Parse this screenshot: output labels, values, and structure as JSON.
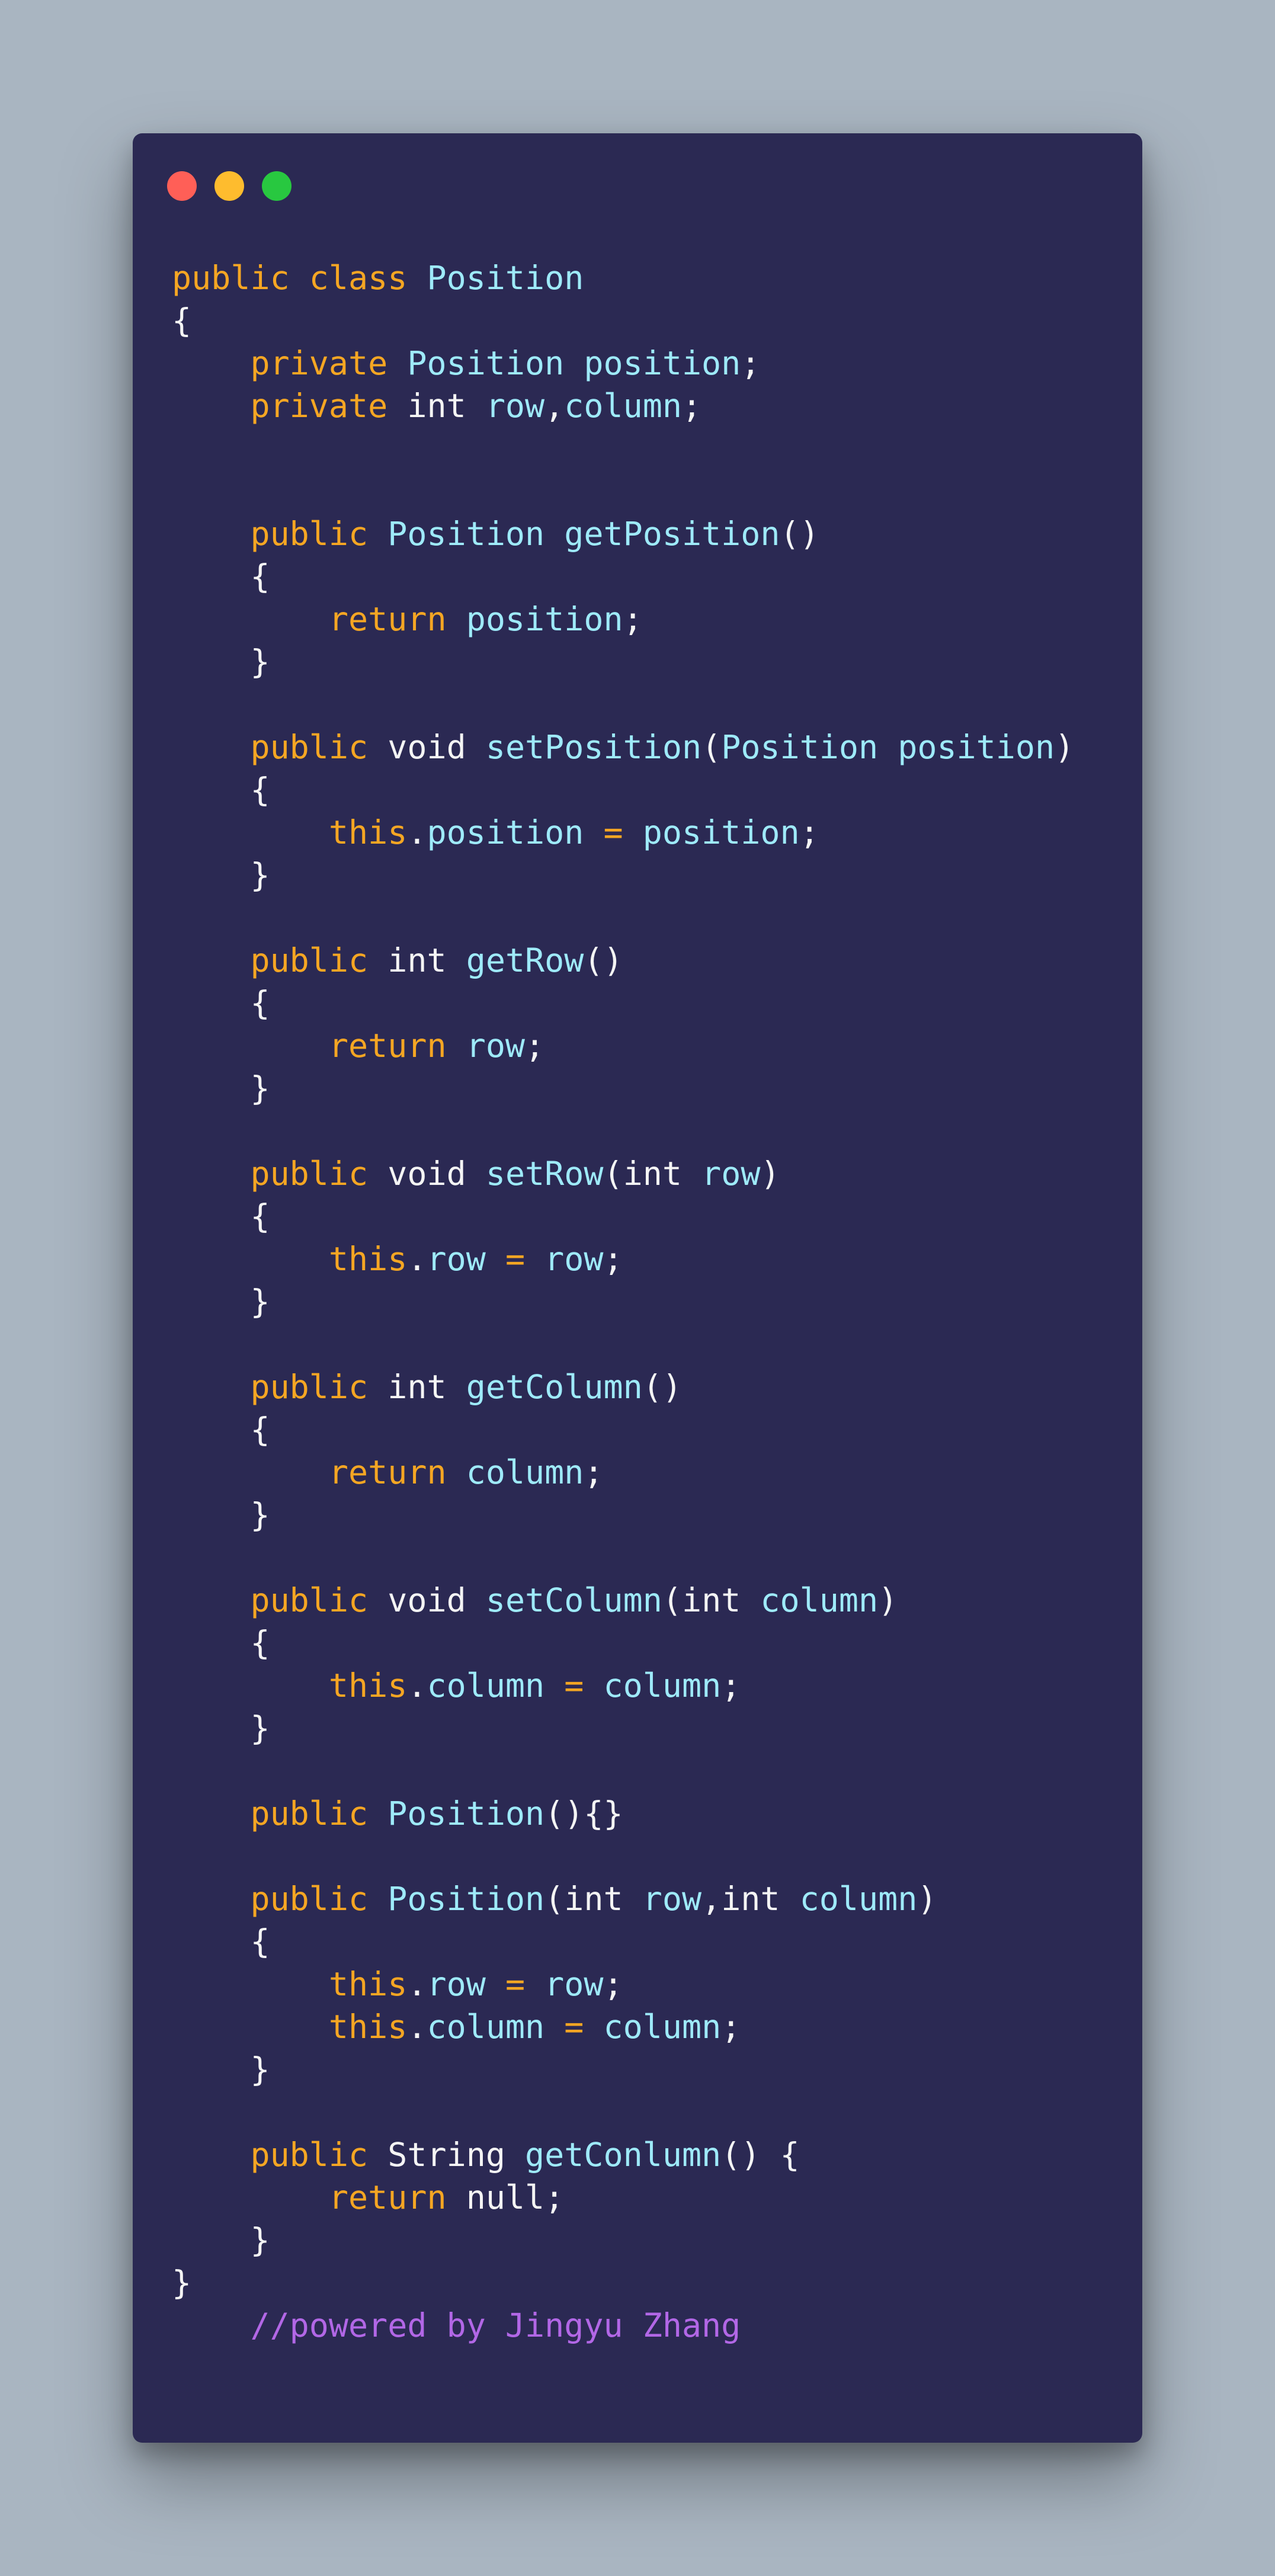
{
  "window": {
    "colors": {
      "background": "#a9b5c1",
      "editor": "#2b2953",
      "keyword": "#f5a623",
      "identifier": "#9eeaf9",
      "plain": "#f4f4f4",
      "comment": "#b267e6"
    },
    "controls": [
      "close-dot",
      "minimize-dot",
      "maximize-dot"
    ]
  },
  "code_lines": [
    [
      {
        "t": "public class ",
        "c": "kw"
      },
      {
        "t": "Position",
        "c": "id"
      }
    ],
    [
      {
        "t": "{",
        "c": "pl"
      }
    ],
    [
      {
        "t": "    private ",
        "c": "kw"
      },
      {
        "t": "Position position",
        "c": "id"
      },
      {
        "t": ";",
        "c": "pl"
      }
    ],
    [
      {
        "t": "    private ",
        "c": "kw"
      },
      {
        "t": "int ",
        "c": "pl"
      },
      {
        "t": "row",
        "c": "id"
      },
      {
        "t": ",",
        "c": "pl"
      },
      {
        "t": "column",
        "c": "id"
      },
      {
        "t": ";",
        "c": "pl"
      }
    ],
    [],
    [],
    [
      {
        "t": "    public ",
        "c": "kw"
      },
      {
        "t": "Position getPosition",
        "c": "id"
      },
      {
        "t": "()",
        "c": "pl"
      }
    ],
    [
      {
        "t": "    {",
        "c": "pl"
      }
    ],
    [
      {
        "t": "        return ",
        "c": "kw"
      },
      {
        "t": "position",
        "c": "id"
      },
      {
        "t": ";",
        "c": "pl"
      }
    ],
    [
      {
        "t": "    }",
        "c": "pl"
      }
    ],
    [],
    [
      {
        "t": "    public ",
        "c": "kw"
      },
      {
        "t": "void ",
        "c": "pl"
      },
      {
        "t": "setPosition",
        "c": "id"
      },
      {
        "t": "(",
        "c": "pl"
      },
      {
        "t": "Position position",
        "c": "id"
      },
      {
        "t": ")",
        "c": "pl"
      }
    ],
    [
      {
        "t": "    {",
        "c": "pl"
      }
    ],
    [
      {
        "t": "        this",
        "c": "kw"
      },
      {
        "t": ".",
        "c": "pl"
      },
      {
        "t": "position ",
        "c": "id"
      },
      {
        "t": "= ",
        "c": "kw"
      },
      {
        "t": "position",
        "c": "id"
      },
      {
        "t": ";",
        "c": "pl"
      }
    ],
    [
      {
        "t": "    }",
        "c": "pl"
      }
    ],
    [],
    [
      {
        "t": "    public ",
        "c": "kw"
      },
      {
        "t": "int ",
        "c": "pl"
      },
      {
        "t": "getRow",
        "c": "id"
      },
      {
        "t": "()",
        "c": "pl"
      }
    ],
    [
      {
        "t": "    {",
        "c": "pl"
      }
    ],
    [
      {
        "t": "        return ",
        "c": "kw"
      },
      {
        "t": "row",
        "c": "id"
      },
      {
        "t": ";",
        "c": "pl"
      }
    ],
    [
      {
        "t": "    }",
        "c": "pl"
      }
    ],
    [],
    [
      {
        "t": "    public ",
        "c": "kw"
      },
      {
        "t": "void ",
        "c": "pl"
      },
      {
        "t": "setRow",
        "c": "id"
      },
      {
        "t": "(int ",
        "c": "pl"
      },
      {
        "t": "row",
        "c": "id"
      },
      {
        "t": ")",
        "c": "pl"
      }
    ],
    [
      {
        "t": "    {",
        "c": "pl"
      }
    ],
    [
      {
        "t": "        this",
        "c": "kw"
      },
      {
        "t": ".",
        "c": "pl"
      },
      {
        "t": "row ",
        "c": "id"
      },
      {
        "t": "= ",
        "c": "kw"
      },
      {
        "t": "row",
        "c": "id"
      },
      {
        "t": ";",
        "c": "pl"
      }
    ],
    [
      {
        "t": "    }",
        "c": "pl"
      }
    ],
    [],
    [
      {
        "t": "    public ",
        "c": "kw"
      },
      {
        "t": "int ",
        "c": "pl"
      },
      {
        "t": "getColumn",
        "c": "id"
      },
      {
        "t": "()",
        "c": "pl"
      }
    ],
    [
      {
        "t": "    {",
        "c": "pl"
      }
    ],
    [
      {
        "t": "        return ",
        "c": "kw"
      },
      {
        "t": "column",
        "c": "id"
      },
      {
        "t": ";",
        "c": "pl"
      }
    ],
    [
      {
        "t": "    }",
        "c": "pl"
      }
    ],
    [],
    [
      {
        "t": "    public ",
        "c": "kw"
      },
      {
        "t": "void ",
        "c": "pl"
      },
      {
        "t": "setColumn",
        "c": "id"
      },
      {
        "t": "(int ",
        "c": "pl"
      },
      {
        "t": "column",
        "c": "id"
      },
      {
        "t": ")",
        "c": "pl"
      }
    ],
    [
      {
        "t": "    {",
        "c": "pl"
      }
    ],
    [
      {
        "t": "        this",
        "c": "kw"
      },
      {
        "t": ".",
        "c": "pl"
      },
      {
        "t": "column ",
        "c": "id"
      },
      {
        "t": "= ",
        "c": "kw"
      },
      {
        "t": "column",
        "c": "id"
      },
      {
        "t": ";",
        "c": "pl"
      }
    ],
    [
      {
        "t": "    }",
        "c": "pl"
      }
    ],
    [],
    [
      {
        "t": "    public ",
        "c": "kw"
      },
      {
        "t": "Position",
        "c": "id"
      },
      {
        "t": "(){}",
        "c": "pl"
      }
    ],
    [],
    [
      {
        "t": "    public ",
        "c": "kw"
      },
      {
        "t": "Position",
        "c": "id"
      },
      {
        "t": "(int ",
        "c": "pl"
      },
      {
        "t": "row",
        "c": "id"
      },
      {
        "t": ",int ",
        "c": "pl"
      },
      {
        "t": "column",
        "c": "id"
      },
      {
        "t": ")",
        "c": "pl"
      }
    ],
    [
      {
        "t": "    {",
        "c": "pl"
      }
    ],
    [
      {
        "t": "        this",
        "c": "kw"
      },
      {
        "t": ".",
        "c": "pl"
      },
      {
        "t": "row ",
        "c": "id"
      },
      {
        "t": "= ",
        "c": "kw"
      },
      {
        "t": "row",
        "c": "id"
      },
      {
        "t": ";",
        "c": "pl"
      }
    ],
    [
      {
        "t": "        this",
        "c": "kw"
      },
      {
        "t": ".",
        "c": "pl"
      },
      {
        "t": "column ",
        "c": "id"
      },
      {
        "t": "= ",
        "c": "kw"
      },
      {
        "t": "column",
        "c": "id"
      },
      {
        "t": ";",
        "c": "pl"
      }
    ],
    [
      {
        "t": "    }",
        "c": "pl"
      }
    ],
    [],
    [
      {
        "t": "    public ",
        "c": "kw"
      },
      {
        "t": "String ",
        "c": "pl"
      },
      {
        "t": "getConlumn",
        "c": "id"
      },
      {
        "t": "() {",
        "c": "pl"
      }
    ],
    [
      {
        "t": "        return ",
        "c": "kw"
      },
      {
        "t": "null;",
        "c": "pl"
      }
    ],
    [
      {
        "t": "    }",
        "c": "pl"
      }
    ],
    [
      {
        "t": "}",
        "c": "pl"
      }
    ],
    [
      {
        "t": "    //powered by Jingyu Zhang",
        "c": "cm"
      }
    ]
  ]
}
